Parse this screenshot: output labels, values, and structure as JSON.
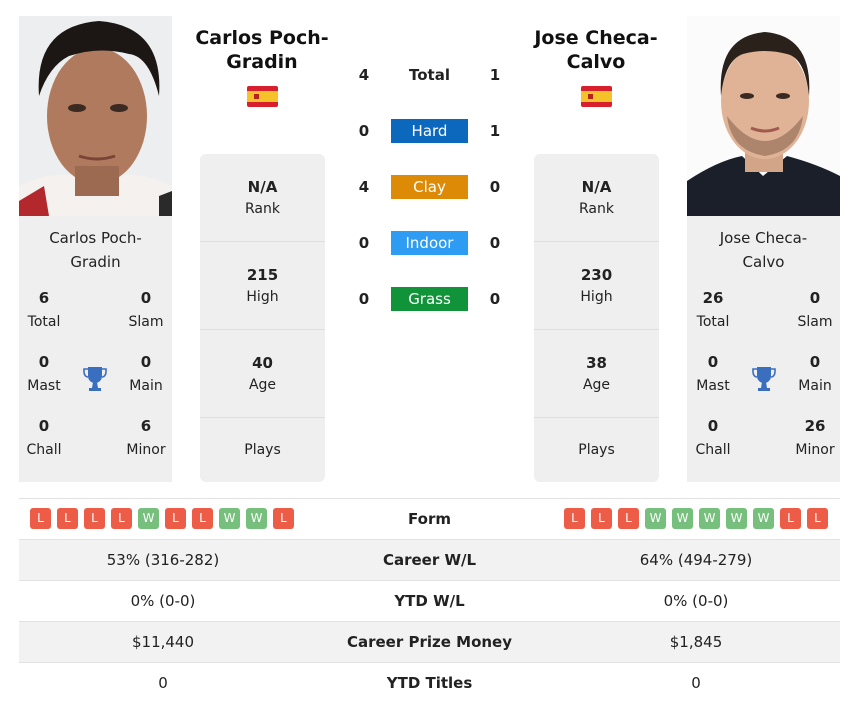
{
  "colors": {
    "hard": "#0b68bd",
    "clay": "#dd8b07",
    "indoor": "#2e9cf2",
    "grass": "#109339",
    "win": "#76bf7c",
    "loss": "#ec5c46",
    "trophy": "#3a6fc0"
  },
  "player1": {
    "name": "Carlos Poch-Gradin",
    "name_line1": "Carlos Poch-",
    "name_line2": "Gradin",
    "flag": "spain-flag",
    "titles": {
      "total": {
        "value": "6",
        "label": "Total"
      },
      "slam": {
        "value": "0",
        "label": "Slam"
      },
      "mast": {
        "value": "0",
        "label": "Mast"
      },
      "main": {
        "value": "0",
        "label": "Main"
      },
      "chall": {
        "value": "0",
        "label": "Chall"
      },
      "minor": {
        "value": "6",
        "label": "Minor"
      }
    },
    "stats": [
      {
        "value": "N/A",
        "label": "Rank"
      },
      {
        "value": "215",
        "label": "High"
      },
      {
        "value": "40",
        "label": "Age"
      },
      {
        "value": "",
        "label": "Plays"
      }
    ],
    "form": [
      "L",
      "L",
      "L",
      "L",
      "W",
      "L",
      "L",
      "W",
      "W",
      "L"
    ],
    "career_wl": "53% (316-282)",
    "ytd_wl": "0% (0-0)",
    "prize_money": "$11,440",
    "ytd_titles": "0"
  },
  "player2": {
    "name": "Jose Checa-Calvo",
    "name_line1": "Jose Checa-",
    "name_line2": "Calvo",
    "flag": "spain-flag",
    "titles": {
      "total": {
        "value": "26",
        "label": "Total"
      },
      "slam": {
        "value": "0",
        "label": "Slam"
      },
      "mast": {
        "value": "0",
        "label": "Mast"
      },
      "main": {
        "value": "0",
        "label": "Main"
      },
      "chall": {
        "value": "0",
        "label": "Chall"
      },
      "minor": {
        "value": "26",
        "label": "Minor"
      }
    },
    "stats": [
      {
        "value": "N/A",
        "label": "Rank"
      },
      {
        "value": "230",
        "label": "High"
      },
      {
        "value": "38",
        "label": "Age"
      },
      {
        "value": "",
        "label": "Plays"
      }
    ],
    "form": [
      "L",
      "L",
      "L",
      "W",
      "W",
      "W",
      "W",
      "W",
      "L",
      "L"
    ],
    "career_wl": "64% (494-279)",
    "ytd_wl": "0% (0-0)",
    "prize_money": "$1,845",
    "ytd_titles": "0"
  },
  "h2h": [
    {
      "label": "Total",
      "p1": "4",
      "p2": "1",
      "key": "total"
    },
    {
      "label": "Hard",
      "p1": "0",
      "p2": "1",
      "key": "hard"
    },
    {
      "label": "Clay",
      "p1": "4",
      "p2": "0",
      "key": "clay"
    },
    {
      "label": "Indoor",
      "p1": "0",
      "p2": "0",
      "key": "indoor"
    },
    {
      "label": "Grass",
      "p1": "0",
      "p2": "0",
      "key": "grass"
    }
  ],
  "table_labels": {
    "form": "Form",
    "career_wl": "Career W/L",
    "ytd_wl": "YTD W/L",
    "prize_money": "Career Prize Money",
    "ytd_titles": "YTD Titles"
  }
}
